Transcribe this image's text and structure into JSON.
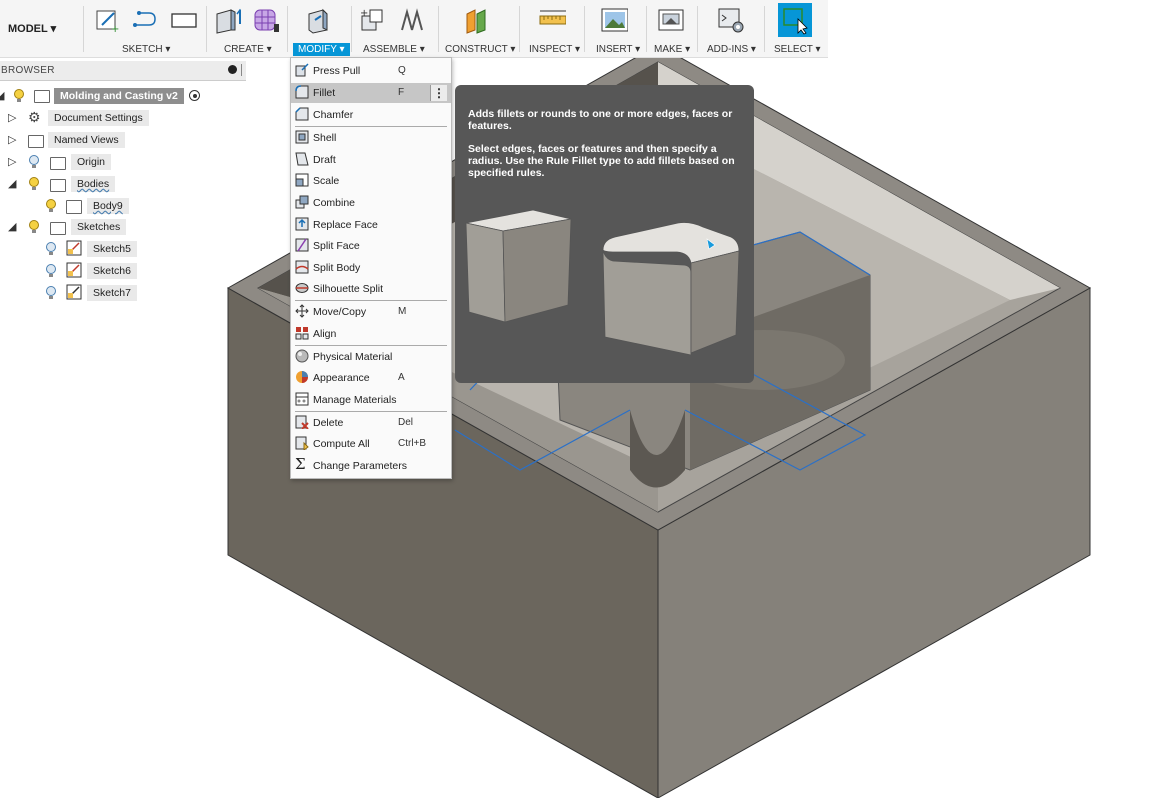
{
  "toolbar": {
    "model_label": "MODEL ▾",
    "groups": [
      {
        "label": "SKETCH ▾"
      },
      {
        "label": "CREATE ▾"
      },
      {
        "label": "MODIFY ▾"
      },
      {
        "label": "ASSEMBLE ▾"
      },
      {
        "label": "CONSTRUCT ▾"
      },
      {
        "label": "INSPECT ▾"
      },
      {
        "label": "INSERT ▾"
      },
      {
        "label": "MAKE ▾"
      },
      {
        "label": "ADD-INS ▾"
      },
      {
        "label": "SELECT ▾"
      }
    ],
    "accent": "#0696d7"
  },
  "browser": {
    "title": "BROWSER",
    "root": "Molding and Casting v2",
    "items": [
      {
        "label": "Document Settings",
        "icon": "gear-icon"
      },
      {
        "label": "Named Views",
        "icon": "folder-icon"
      },
      {
        "label": "Origin",
        "icon": "folder-icon"
      },
      {
        "label": "Bodies",
        "icon": "folder-icon"
      },
      {
        "label": "Body9",
        "icon": "body-icon"
      },
      {
        "label": "Sketches",
        "icon": "folder-icon"
      },
      {
        "label": "Sketch5",
        "icon": "sketch-icon"
      },
      {
        "label": "Sketch6",
        "icon": "sketch-icon"
      },
      {
        "label": "Sketch7",
        "icon": "sketch-icon"
      }
    ]
  },
  "modify_menu": {
    "items": [
      {
        "label": "Press Pull",
        "shortcut": "Q",
        "icon": "press-pull-icon"
      },
      {
        "label": "Fillet",
        "shortcut": "F",
        "icon": "fillet-icon",
        "highlighted": true
      },
      {
        "label": "Chamfer",
        "shortcut": "",
        "icon": "chamfer-icon"
      },
      {
        "label": "Shell",
        "shortcut": "",
        "icon": "shell-icon"
      },
      {
        "label": "Draft",
        "shortcut": "",
        "icon": "draft-icon"
      },
      {
        "label": "Scale",
        "shortcut": "",
        "icon": "scale-icon"
      },
      {
        "label": "Combine",
        "shortcut": "",
        "icon": "combine-icon"
      },
      {
        "label": "Replace Face",
        "shortcut": "",
        "icon": "replace-face-icon"
      },
      {
        "label": "Split Face",
        "shortcut": "",
        "icon": "split-face-icon"
      },
      {
        "label": "Split Body",
        "shortcut": "",
        "icon": "split-body-icon"
      },
      {
        "label": "Silhouette Split",
        "shortcut": "",
        "icon": "silhouette-split-icon"
      },
      {
        "label": "Move/Copy",
        "shortcut": "M",
        "icon": "move-icon"
      },
      {
        "label": "Align",
        "shortcut": "",
        "icon": "align-icon"
      },
      {
        "label": "Physical Material",
        "shortcut": "",
        "icon": "physical-material-icon"
      },
      {
        "label": "Appearance",
        "shortcut": "A",
        "icon": "appearance-icon"
      },
      {
        "label": "Manage Materials",
        "shortcut": "",
        "icon": "manage-materials-icon"
      },
      {
        "label": "Delete",
        "shortcut": "Del",
        "icon": "delete-icon"
      },
      {
        "label": "Compute All",
        "shortcut": "Ctrl+B",
        "icon": "compute-icon"
      },
      {
        "label": "Change Parameters",
        "shortcut": "",
        "icon": "sigma-icon"
      }
    ]
  },
  "tooltip": {
    "line1": "Adds fillets or rounds to one or more edges, faces or features.",
    "line2": "Select edges, faces or features and then specify a radius. Use the Rule Fillet type to add fillets based on specified rules."
  }
}
